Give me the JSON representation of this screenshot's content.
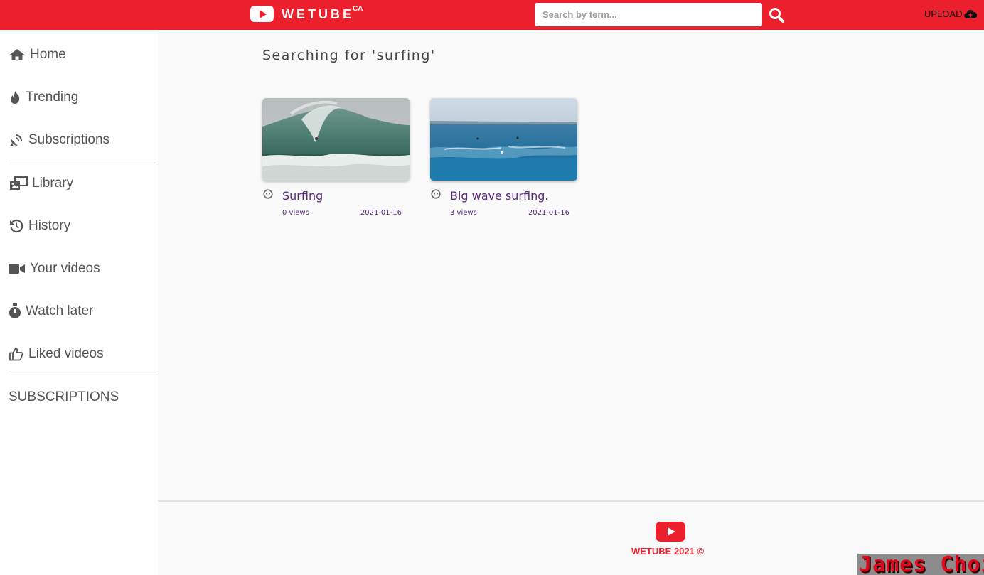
{
  "header": {
    "logo_text": "WETUBE",
    "logo_sup": "CA",
    "search_placeholder": "Search by term...",
    "upload_label": "UPLOAD",
    "accent_color": "#ec1f2c"
  },
  "sidebar": {
    "items": [
      {
        "label": "Home",
        "icon": "home-icon"
      },
      {
        "label": "Trending",
        "icon": "fire-icon"
      },
      {
        "label": "Subscriptions",
        "icon": "satellite-dish-icon"
      },
      {
        "label": "Library",
        "icon": "photo-video-icon"
      },
      {
        "label": "History",
        "icon": "history-icon"
      },
      {
        "label": "Your videos",
        "icon": "video-camera-icon"
      },
      {
        "label": "Watch later",
        "icon": "stopwatch-icon"
      },
      {
        "label": "Liked videos",
        "icon": "thumbs-up-icon"
      }
    ],
    "heading": "SUBSCRIPTIONS"
  },
  "main": {
    "heading": "Searching for 'surfing'",
    "videos": [
      {
        "title": "Surfing",
        "views": "0 views",
        "date": "2021-01-16"
      },
      {
        "title": "Big wave surfing.",
        "views": "3 views",
        "date": "2021-01-16"
      }
    ]
  },
  "footer": {
    "text": "WETUBE 2021 ©",
    "signature": "James Choi"
  }
}
